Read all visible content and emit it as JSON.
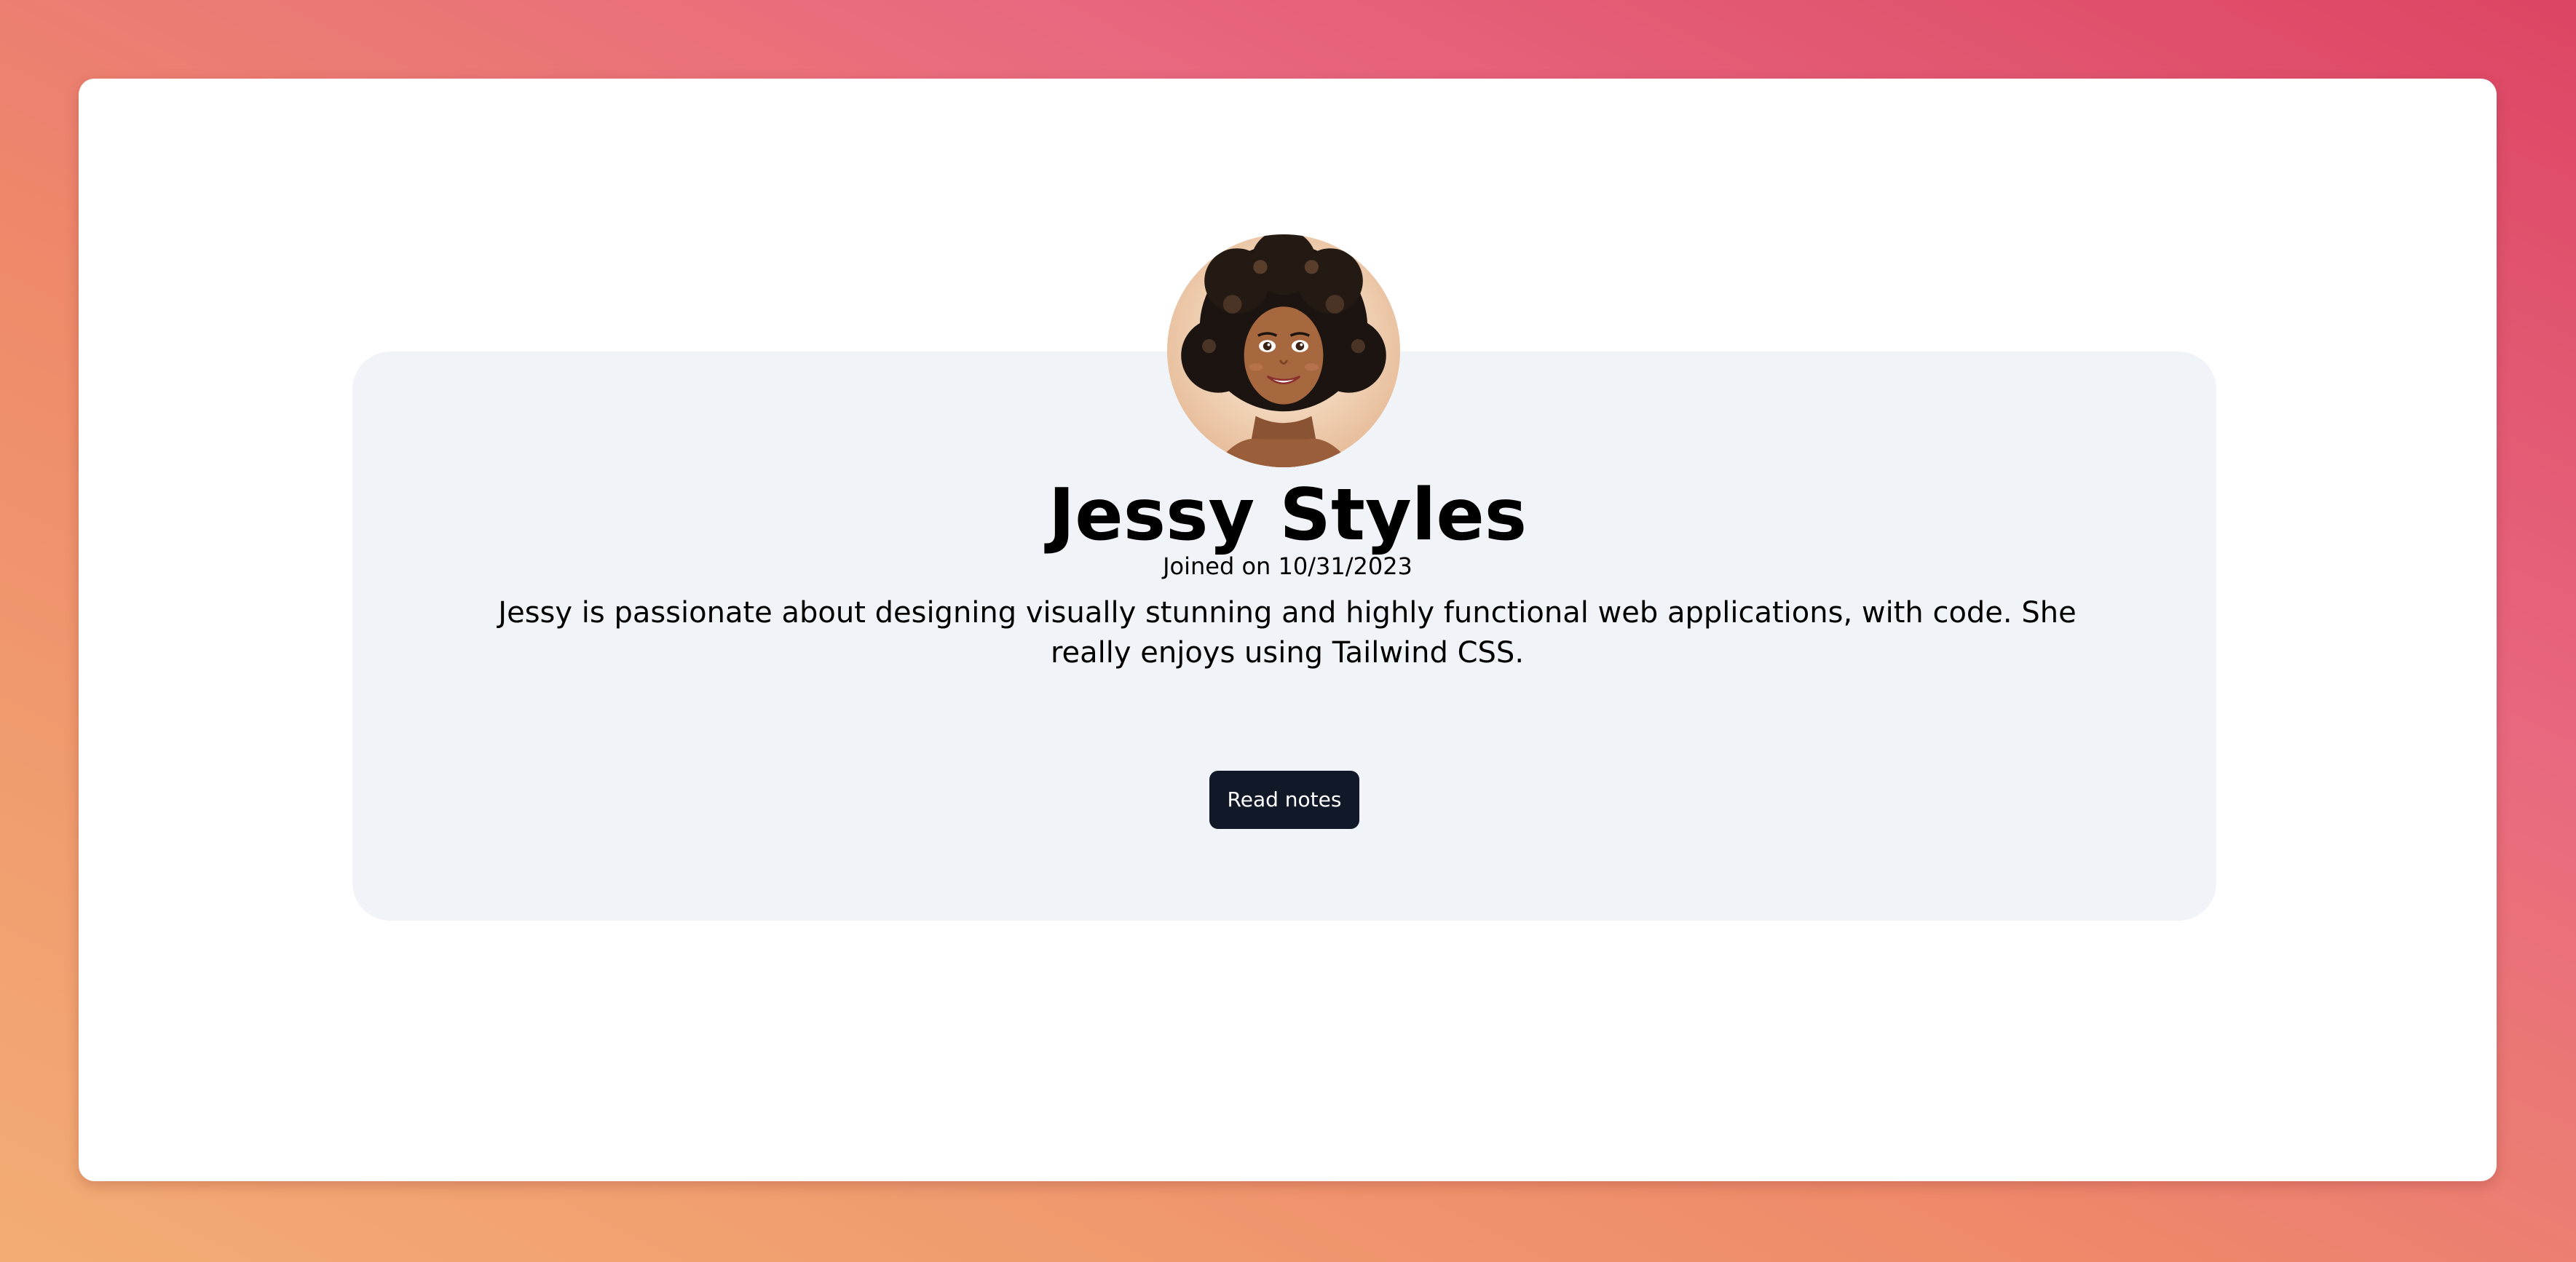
{
  "profile": {
    "name": "Jessy Styles",
    "joined": "Joined on 10/31/2023",
    "bio": "Jessy is passionate about designing visually stunning and highly functional web applications, with code. She really enjoys using Tailwind CSS.",
    "avatar_icon": "avatar-portrait-icon"
  },
  "actions": {
    "read_notes_label": "Read notes"
  },
  "colors": {
    "button_bg": "#111827",
    "panel_bg": "#f0f4f9",
    "card_bg": "#ffffff",
    "gradient_start": "#f3ad74",
    "gradient_end": "#dc4563"
  }
}
